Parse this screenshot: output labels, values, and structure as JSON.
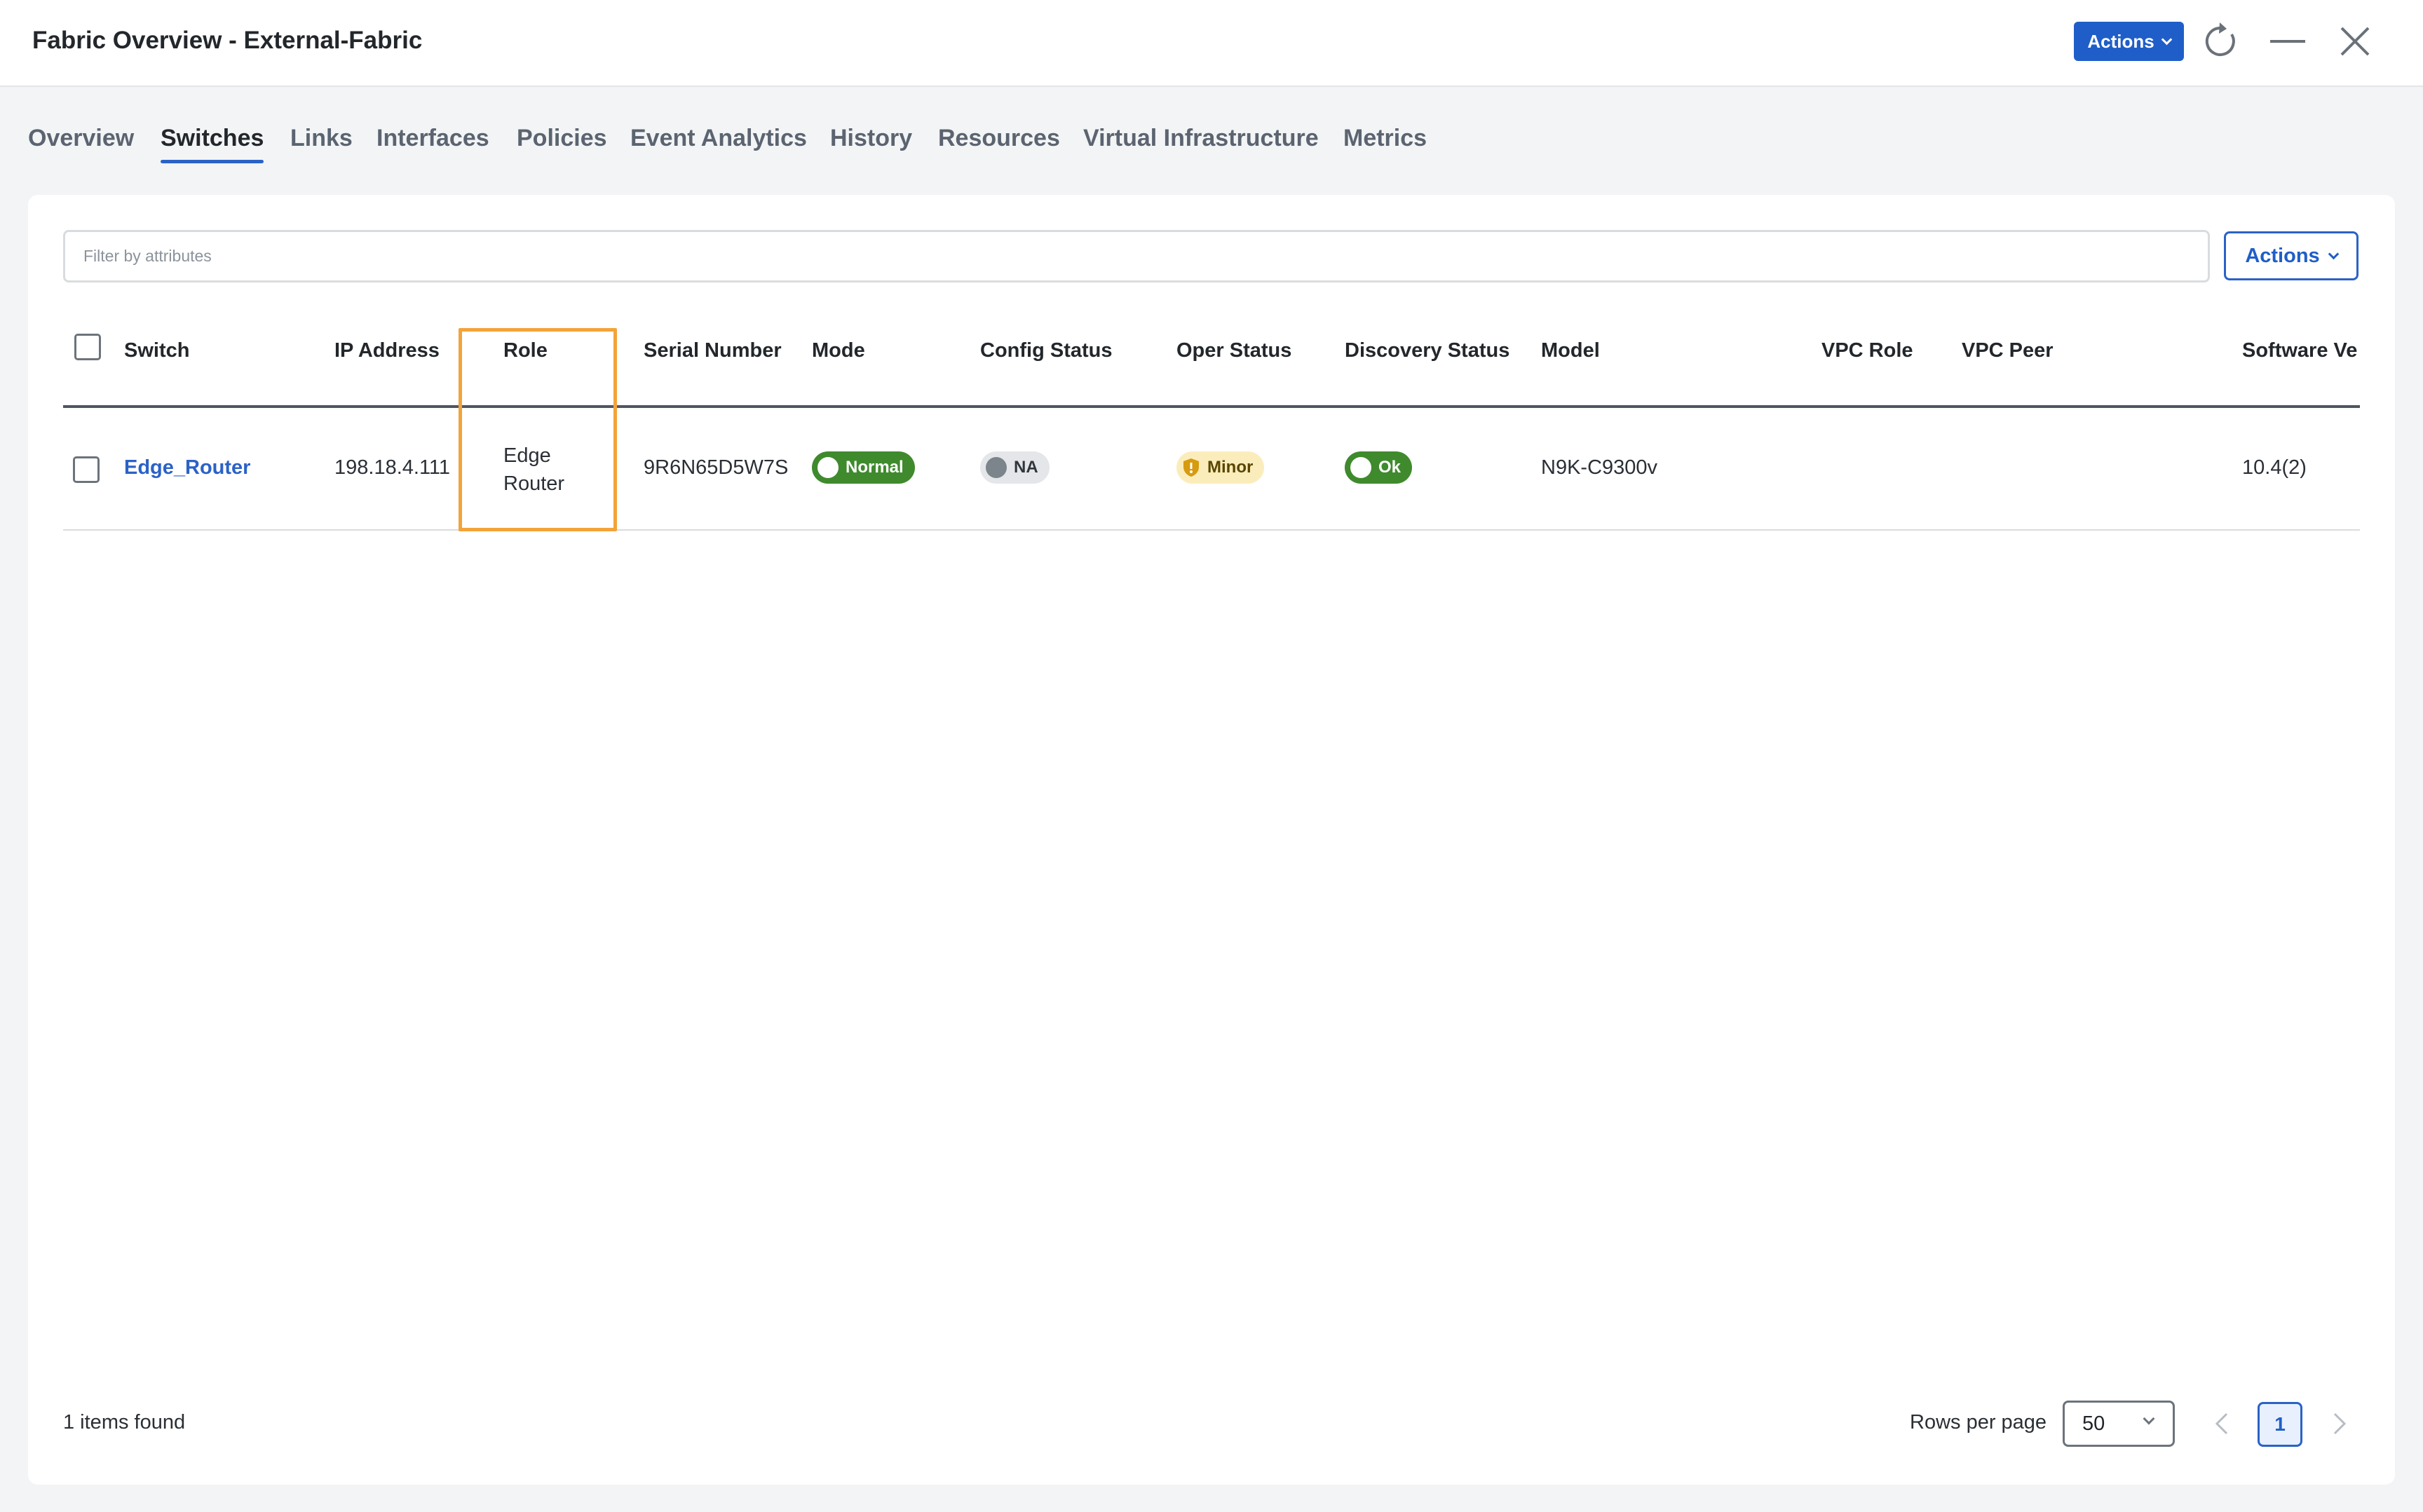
{
  "window": {
    "title": "Fabric Overview - External-Fabric",
    "actions_label": "Actions",
    "icons": [
      "refresh-icon",
      "minimize-icon",
      "close-icon"
    ]
  },
  "tabs": [
    {
      "label": "Overview",
      "active": false
    },
    {
      "label": "Switches",
      "active": true
    },
    {
      "label": "Links",
      "active": false
    },
    {
      "label": "Interfaces",
      "active": false
    },
    {
      "label": "Policies",
      "active": false
    },
    {
      "label": "Event Analytics",
      "active": false
    },
    {
      "label": "History",
      "active": false
    },
    {
      "label": "Resources",
      "active": false
    },
    {
      "label": "Virtual Infrastructure",
      "active": false
    },
    {
      "label": "Metrics",
      "active": false
    }
  ],
  "filter": {
    "placeholder": "Filter by attributes"
  },
  "panel": {
    "actions_label": "Actions"
  },
  "table": {
    "columns": [
      "Switch",
      "IP Address",
      "Role",
      "Serial Number",
      "Mode",
      "Config Status",
      "Oper Status",
      "Discovery Status",
      "Model",
      "VPC Role",
      "VPC Peer",
      "Software Ve"
    ],
    "rows": [
      {
        "switch": "Edge_Router",
        "ip": "198.18.4.111",
        "role_line1": "Edge",
        "role_line2": "Router",
        "serial": "9R6N65D5W7S",
        "mode": "Normal",
        "config_status": "NA",
        "oper_status": "Minor",
        "discovery_status": "Ok",
        "model": "N9K-C9300v",
        "vpc_role": "",
        "vpc_peer": "",
        "software": "10.4(2)"
      }
    ]
  },
  "footer": {
    "count_text": "1 items found",
    "rows_per_page_label": "Rows per page",
    "rows_per_page_value": "50",
    "current_page": "1"
  },
  "colors": {
    "accent": "#1f5ec8",
    "highlight": "#f3a33a",
    "status_green": "#3f8a2d",
    "status_gray": "#e4e6e9",
    "status_yellow": "#fbedbb"
  }
}
